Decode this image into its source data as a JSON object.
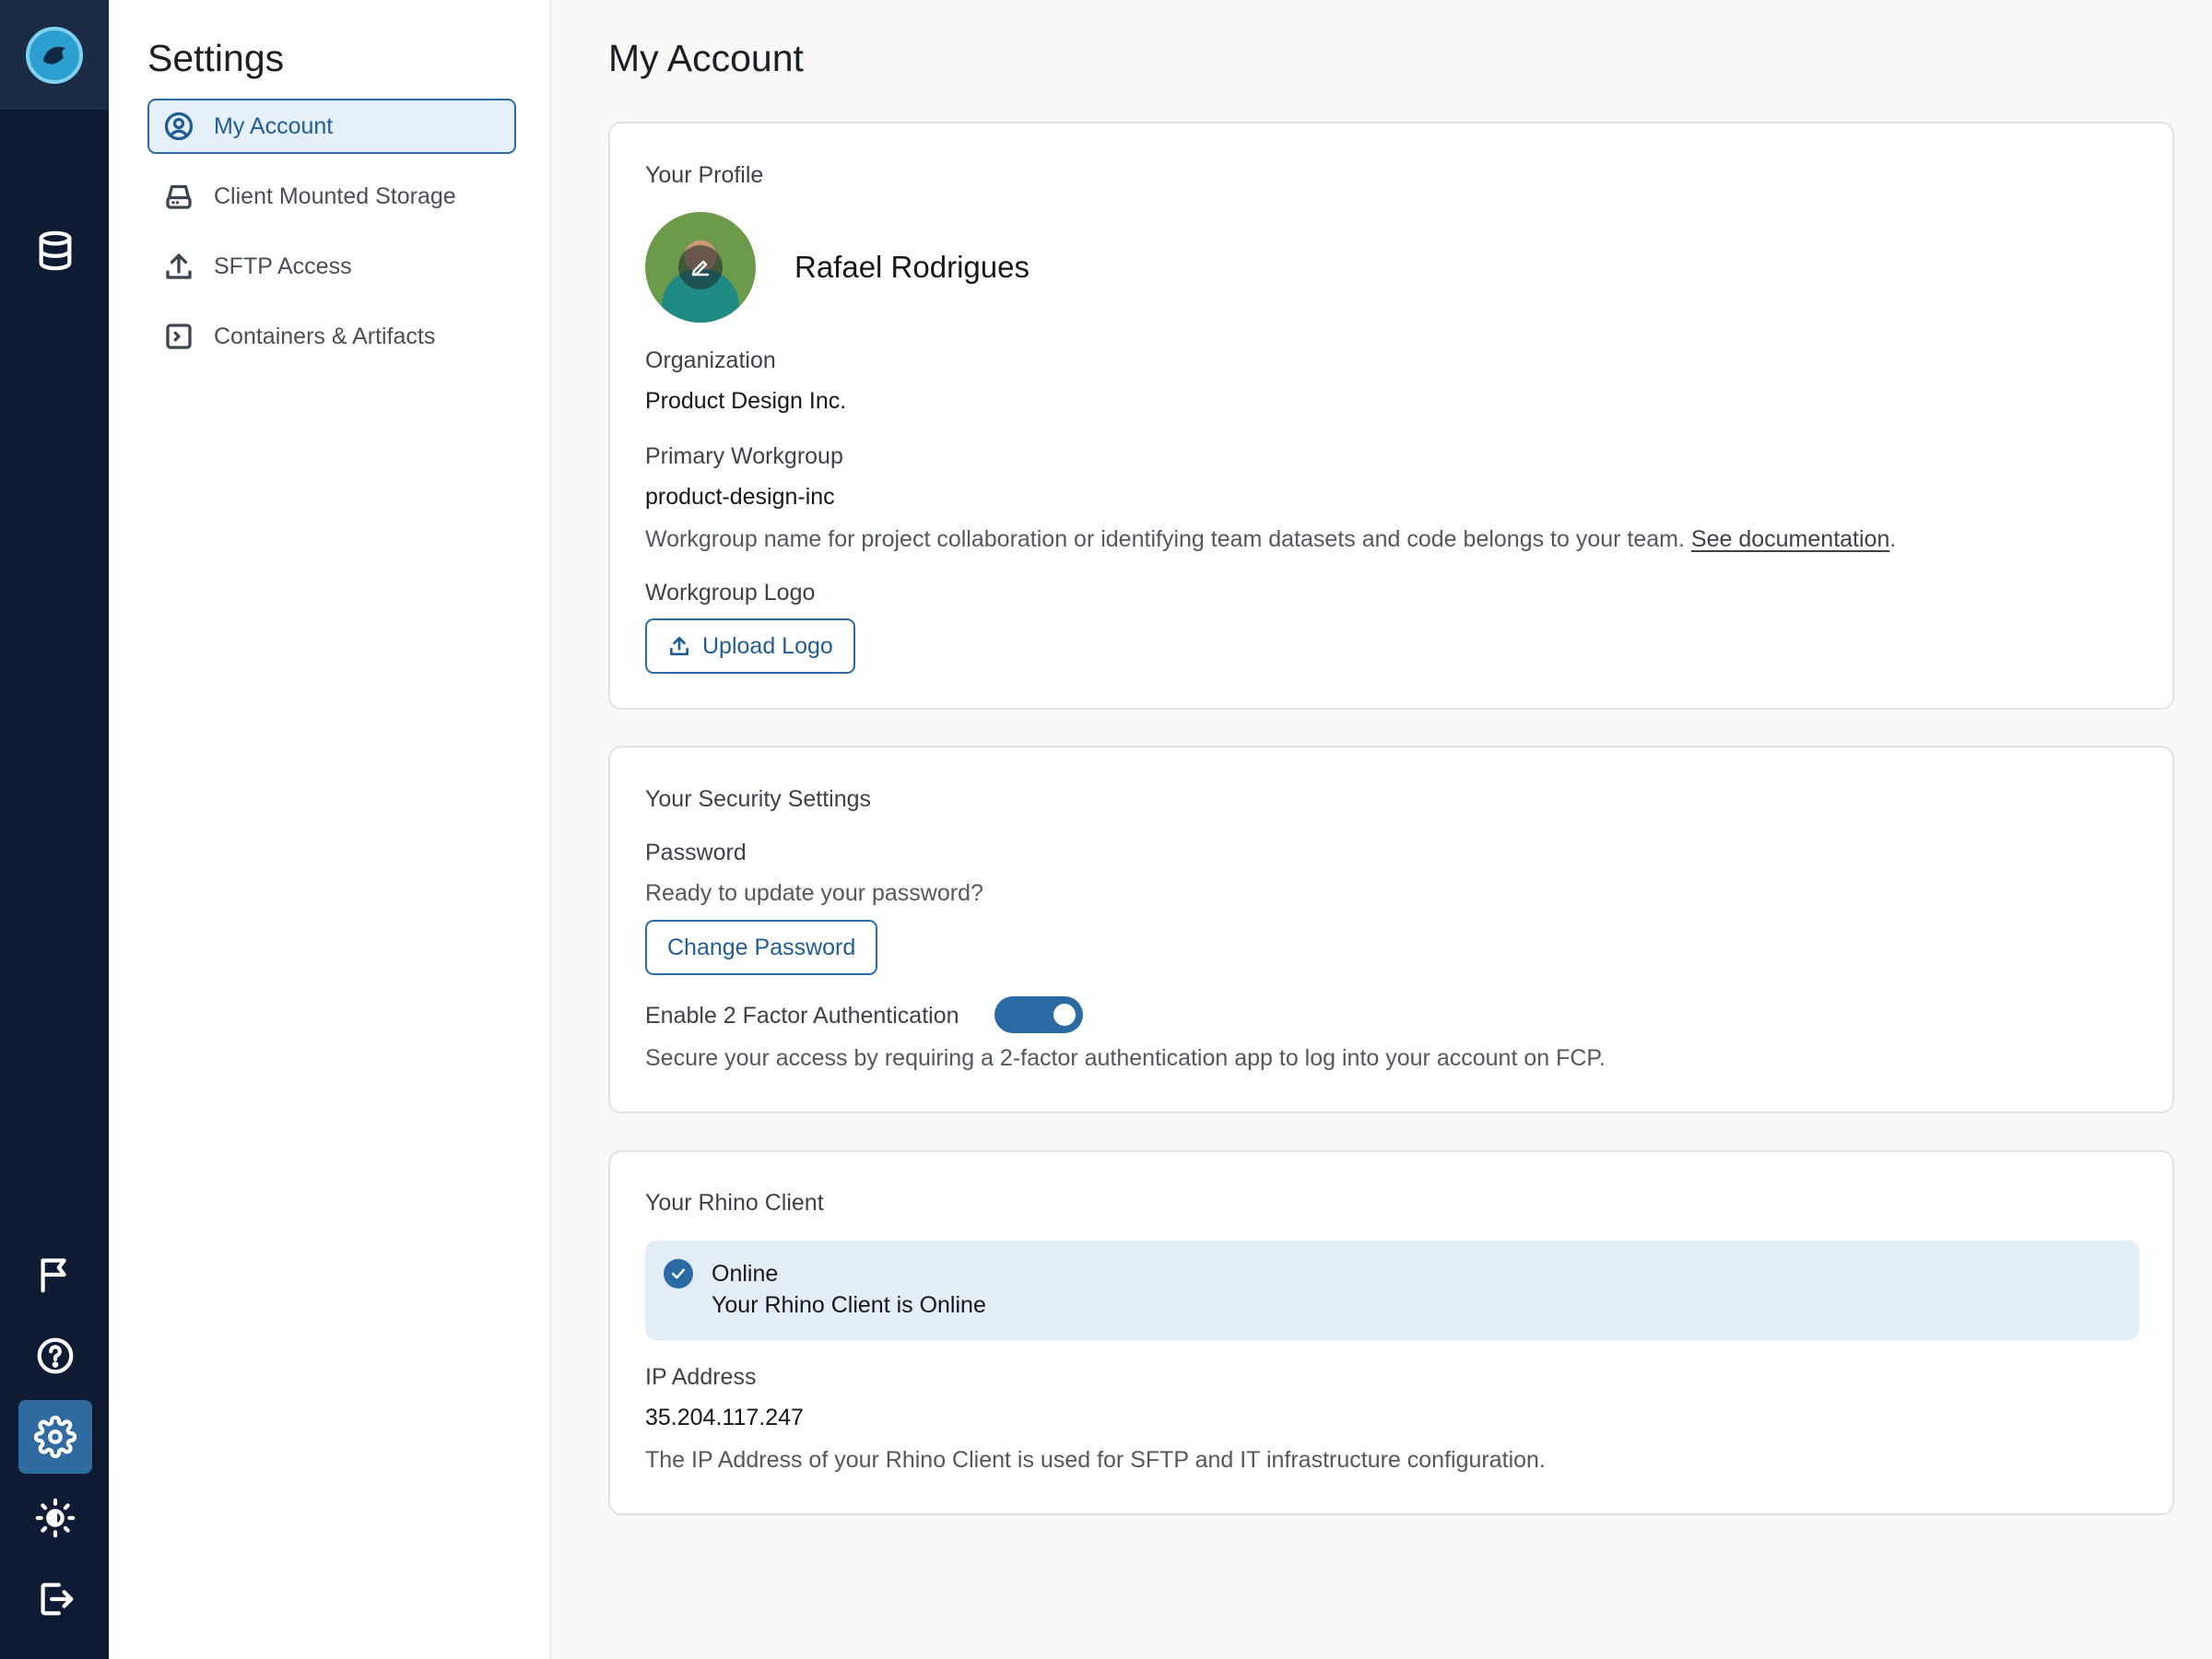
{
  "sidebar": {
    "title": "Settings",
    "items": [
      {
        "label": "My Account",
        "icon": "user-circle-icon",
        "active": true
      },
      {
        "label": "Client Mounted Storage",
        "icon": "hard-drive-icon"
      },
      {
        "label": "SFTP Access",
        "icon": "upload-icon"
      },
      {
        "label": "Containers & Artifacts",
        "icon": "terminal-box-icon"
      }
    ]
  },
  "rail": {
    "icons": [
      "app-logo-icon",
      "database-icon",
      "flag-icon",
      "help-icon",
      "gear-icon",
      "theme-toggle-icon",
      "logout-icon"
    ],
    "active": "gear-icon"
  },
  "main": {
    "title": "My Account",
    "profile": {
      "section_title": "Your Profile",
      "name": "Rafael Rodrigues",
      "organization_label": "Organization",
      "organization": "Product Design Inc.",
      "workgroup_label": "Primary Workgroup",
      "workgroup": "product-design-inc",
      "workgroup_help": "Workgroup name for project collaboration or identifying team datasets and code belongs to your team.",
      "workgroup_help_link": "See documentation",
      "workgroup_help_end": ".",
      "logo_label": "Workgroup Logo",
      "upload_button": "Upload Logo"
    },
    "security": {
      "section_title": "Your Security Settings",
      "password_label": "Password",
      "password_help": "Ready to update your password?",
      "change_password_button": "Change Password",
      "two_factor_label": "Enable 2 Factor Authentication",
      "two_factor_enabled": true,
      "two_factor_help": "Secure your access by requiring a 2-factor authentication app to log into your account on FCP."
    },
    "client": {
      "section_title": "Your Rhino Client",
      "status_title": "Online",
      "status_text": "Your Rhino Client is Online",
      "ip_label": "IP Address",
      "ip": "35.204.117.247",
      "ip_help": "The IP Address of your Rhino Client is used for SFTP and IT infrastructure configuration."
    }
  },
  "colors": {
    "rail_bg": "#0e1b33",
    "accent": "#2a6aa5",
    "active_bg": "#e6f0fa",
    "status_bg": "#e3edf8"
  }
}
